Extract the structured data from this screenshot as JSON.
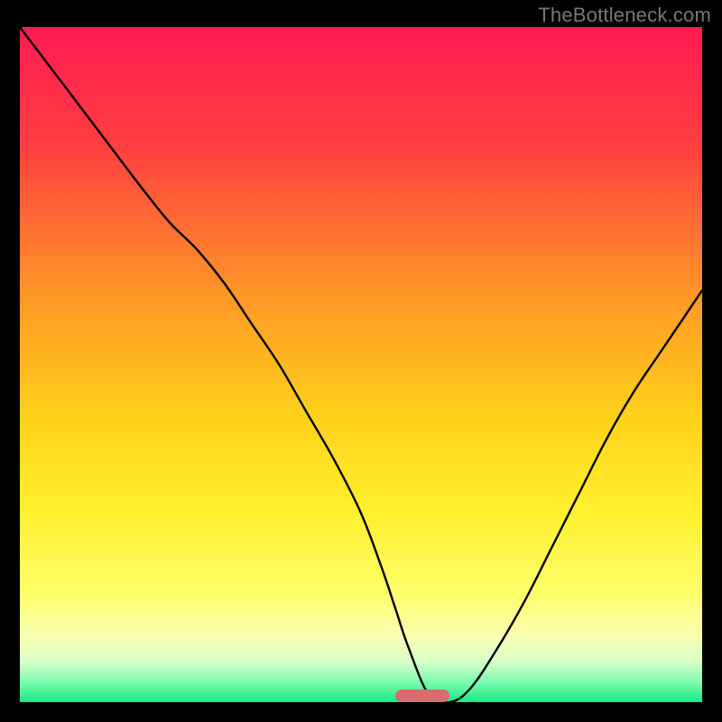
{
  "watermark": "TheBottleneck.com",
  "chart_data": {
    "type": "line",
    "title": "",
    "xlabel": "",
    "ylabel": "",
    "xlim": [
      0,
      100
    ],
    "ylim": [
      0,
      100
    ],
    "grid": false,
    "legend": false,
    "series": [
      {
        "name": "bottleneck-curve",
        "x": [
          0,
          6,
          12,
          18,
          22,
          26,
          30,
          34,
          38,
          42,
          46,
          50,
          53,
          55,
          57,
          60,
          63,
          66,
          70,
          74,
          78,
          82,
          86,
          90,
          94,
          98,
          100
        ],
        "values": [
          100,
          92,
          84,
          76,
          71,
          67,
          62,
          56,
          50,
          43,
          36,
          28,
          20,
          14,
          8,
          1,
          0,
          2,
          8,
          15,
          23,
          31,
          39,
          46,
          52,
          58,
          61
        ]
      }
    ],
    "annotations": [
      {
        "name": "optimal-marker",
        "x_start": 55,
        "x_end": 63,
        "y": 0,
        "color": "#d96b72"
      }
    ],
    "background_gradient_stops": [
      {
        "offset": 0.0,
        "color": "#ff1a52"
      },
      {
        "offset": 0.18,
        "color": "#ff4040"
      },
      {
        "offset": 0.4,
        "color": "#ff9826"
      },
      {
        "offset": 0.58,
        "color": "#ffd21a"
      },
      {
        "offset": 0.72,
        "color": "#fff030"
      },
      {
        "offset": 0.84,
        "color": "#fdff6a"
      },
      {
        "offset": 0.9,
        "color": "#faffb0"
      },
      {
        "offset": 0.94,
        "color": "#d8ffc8"
      },
      {
        "offset": 0.97,
        "color": "#7dfbb0"
      },
      {
        "offset": 1.0,
        "color": "#18e884"
      }
    ]
  }
}
